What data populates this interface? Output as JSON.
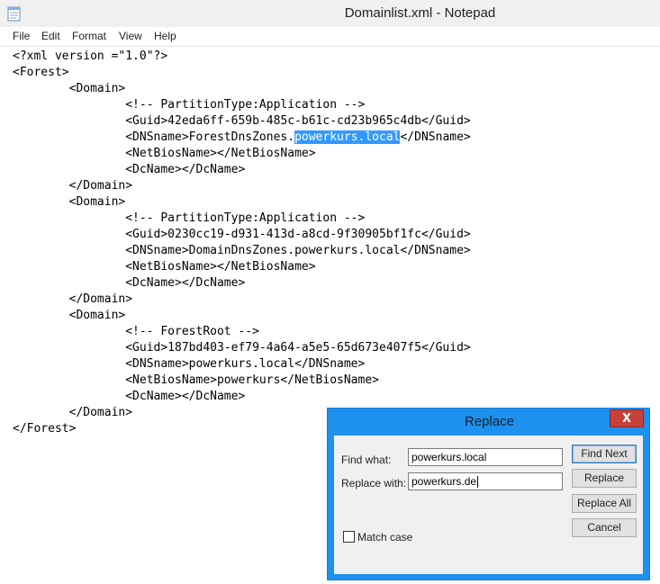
{
  "window": {
    "title": "Domainlist.xml - Notepad"
  },
  "menu": [
    "File",
    "Edit",
    "Format",
    "View",
    "Help"
  ],
  "editor": {
    "lines": [
      {
        "text": "<?xml version =\"1.0\"?>"
      },
      {
        "text": "<Forest>"
      },
      {
        "text": "        <Domain>"
      },
      {
        "text": "                <!-- PartitionType:Application -->"
      },
      {
        "text": "                <Guid>42eda6ff-659b-485c-b61c-cd23b965c4db</Guid>"
      },
      {
        "pre": "                <DNSname>ForestDnsZones.",
        "selected": "powerkurs.local",
        "post": "</DNSname>"
      },
      {
        "text": "                <NetBiosName></NetBiosName>"
      },
      {
        "text": "                <DcName></DcName>"
      },
      {
        "text": "        </Domain>"
      },
      {
        "text": "        <Domain>"
      },
      {
        "text": "                <!-- PartitionType:Application -->"
      },
      {
        "text": "                <Guid>0230cc19-d931-413d-a8cd-9f30905bf1fc</Guid>"
      },
      {
        "text": "                <DNSname>DomainDnsZones.powerkurs.local</DNSname>"
      },
      {
        "text": "                <NetBiosName></NetBiosName>"
      },
      {
        "text": "                <DcName></DcName>"
      },
      {
        "text": "        </Domain>"
      },
      {
        "text": "        <Domain>"
      },
      {
        "text": "                <!-- ForestRoot -->"
      },
      {
        "text": "                <Guid>187bd403-ef79-4a64-a5e5-65d673e407f5</Guid>"
      },
      {
        "text": "                <DNSname>powerkurs.local</DNSname>"
      },
      {
        "text": "                <NetBiosName>powerkurs</NetBiosName>"
      },
      {
        "text": "                <DcName></DcName>"
      },
      {
        "text": "        </Domain>"
      },
      {
        "text": "</Forest>"
      }
    ]
  },
  "dialog": {
    "title": "Replace",
    "close_glyph": "X",
    "find_label": "Find what:",
    "find_value": "powerkurs.local",
    "replace_label": "Replace with:",
    "replace_value": "powerkurs.de",
    "match_case_label": "Match case",
    "match_case_checked": false,
    "buttons": {
      "find_next": "Find Next",
      "replace": "Replace",
      "replace_all": "Replace All",
      "cancel": "Cancel"
    }
  },
  "colors": {
    "selection": "#3399ff",
    "dialog_frame": "#1e90ee",
    "close_button": "#c7403a"
  }
}
